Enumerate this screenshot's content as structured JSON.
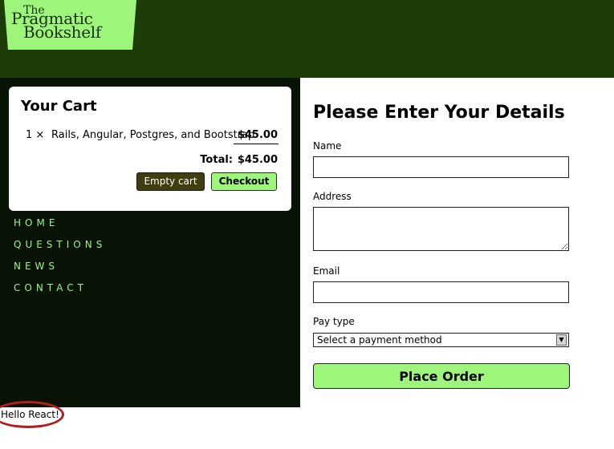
{
  "header": {
    "logo": {
      "line1": "The",
      "line2": "Pragmatic",
      "line3": "Bookshelf"
    },
    "colors": {
      "bar": "#1d3c08",
      "logo_bg": "#9df57c"
    }
  },
  "cart": {
    "heading": "Your Cart",
    "items": [
      {
        "qty": "1 ×",
        "title": "Rails, Angular, Postgres, and Bootstrap",
        "price": "$45.00"
      }
    ],
    "total_label": "Total:",
    "total_value": "$45.00",
    "empty_label": "Empty cart",
    "checkout_label": "Checkout"
  },
  "nav": {
    "items": [
      "HOME",
      "QUESTIONS",
      "NEWS",
      "CONTACT"
    ],
    "color": "#9df57c"
  },
  "form": {
    "heading": "Please Enter Your Details",
    "name_label": "Name",
    "name_value": "",
    "address_label": "Address",
    "address_value": "",
    "email_label": "Email",
    "email_value": "",
    "pay_type_label": "Pay type",
    "pay_type_selected": "Select a payment method",
    "submit_label": "Place Order"
  },
  "footer": {
    "message": "Hello React!"
  }
}
